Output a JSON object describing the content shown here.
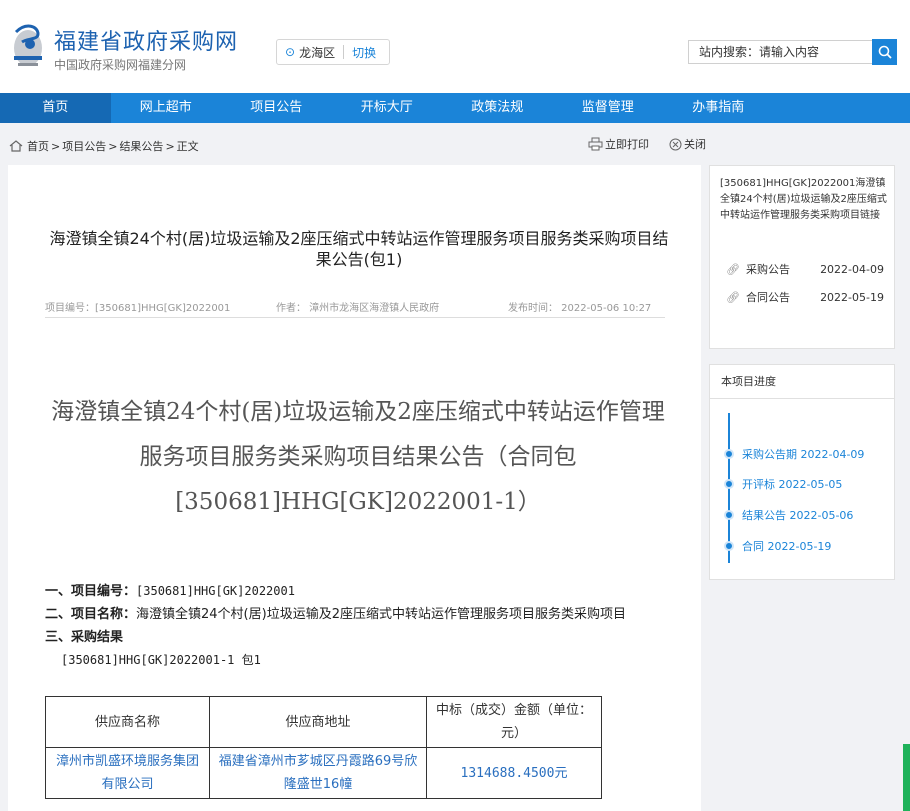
{
  "header": {
    "site_title": "福建省政府采购网",
    "site_subtitle": "中国政府采购网福建分网",
    "region_name": "龙海区",
    "region_switch": "切换",
    "search_label": "站内搜索：请输入内容"
  },
  "nav": [
    "首页",
    "网上超市",
    "项目公告",
    "开标大厅",
    "政策法规",
    "监督管理",
    "办事指南"
  ],
  "breadcrumb": [
    "首页",
    "项目公告",
    "结果公告",
    "正文"
  ],
  "breadcrumb_sep": ">",
  "tools": {
    "print": "立即打印",
    "close": "关闭"
  },
  "article": {
    "title": "海澄镇全镇24个村(居)垃圾运输及2座压缩式中转站运作管理服务项目服务类采购项目结果公告(包1)",
    "meta_code": "项目编号：[350681]HHG[GK]2022001",
    "meta_author": "作者： 漳州市龙海区海澄镇人民政府",
    "meta_time": "发布时间： 2022-05-06 10:27",
    "big_title": "海澄镇全镇24个村(居)垃圾运输及2座压缩式中转站运作管理服务项目服务类采购项目结果公告（合同包[350681]HHG[GK]2022001-1）",
    "s1_label": "一、项目编号：",
    "s1_value": "[350681]HHG[GK]2022001",
    "s2_label": "二、项目名称：",
    "s2_value": "海澄镇全镇24个村(居)垃圾运输及2座压缩式中转站运作管理服务项目服务类采购项目",
    "s3_label": "三、采购结果",
    "package_line": "[350681]HHG[GK]2022001-1 包1",
    "table_headers": [
      "供应商名称",
      "供应商地址",
      "中标（成交）金额（单位：元）"
    ],
    "table_row": [
      "漳州市凯盛环境服务集团有限公司",
      "福建省漳州市芗城区丹霞路69号欣隆盛世16幢",
      "1314688.4500元"
    ]
  },
  "related": {
    "title": "[350681]HHG[GK]2022001海澄镇全镇24个村(居)垃圾运输及2座压缩式中转站运作管理服务类采购项目链接",
    "links": [
      {
        "label": "采购公告",
        "date": "2022-04-09"
      },
      {
        "label": "合同公告",
        "date": "2022-05-19"
      }
    ]
  },
  "progress": {
    "title": "本项目进度",
    "items": [
      "采购公告期 2022-04-09",
      "开评标 2022-05-05",
      "结果公告 2022-05-06",
      "合同 2022-05-19"
    ]
  },
  "colors": {
    "primary": "#1b84d8",
    "nav_active": "#1569b4",
    "link": "#2a6fbf"
  }
}
